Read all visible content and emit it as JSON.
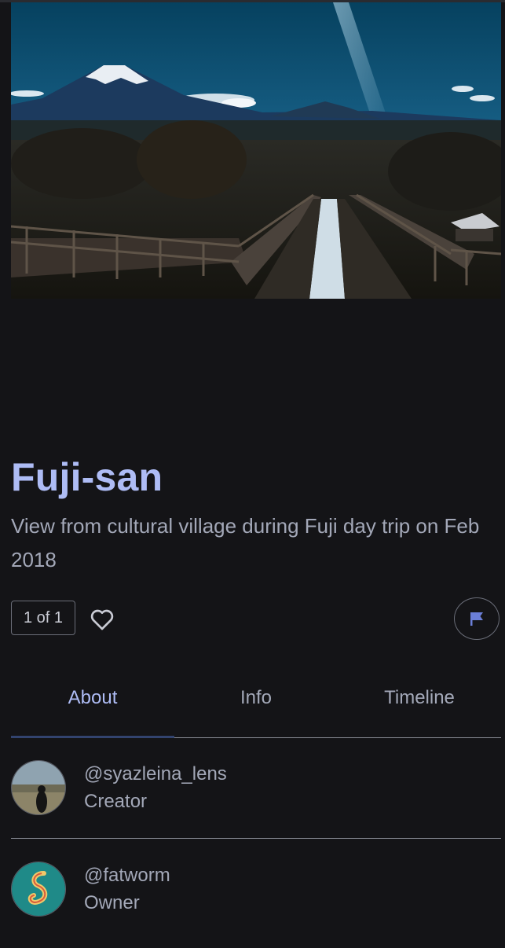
{
  "photo": {
    "title": "Fuji-san",
    "description": "View from cultural village during Fuji day trip on Feb 2018"
  },
  "actions": {
    "counter": "1 of 1",
    "like_icon": "heart-outline-icon",
    "flag_icon": "flag-icon"
  },
  "tabs": [
    {
      "label": "About",
      "active": true
    },
    {
      "label": "Info",
      "active": false
    },
    {
      "label": "Timeline",
      "active": false
    }
  ],
  "people": [
    {
      "handle": "@syazleina_lens",
      "role": "Creator"
    },
    {
      "handle": "@fatworm",
      "role": "Owner"
    }
  ],
  "colors": {
    "background": "#141417",
    "title": "#aebcf5",
    "text": "#a3a8b8",
    "accent_underline": "#32436e",
    "flag": "#6b7fd8"
  }
}
